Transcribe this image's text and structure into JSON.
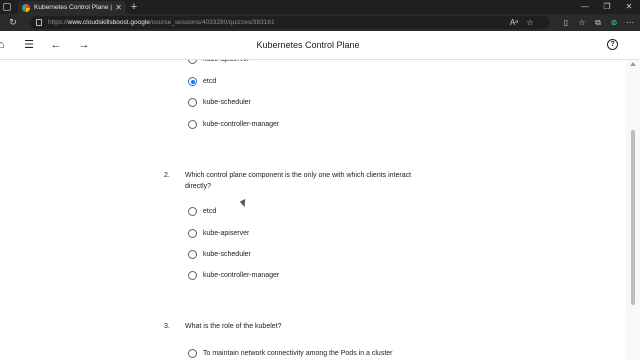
{
  "browser": {
    "tab_title": "Kubernetes Control Plane | Goo",
    "tab_close": "✕",
    "new_tab": "+",
    "url_prefix": "https://",
    "url_host": "www.cloudskillsboost.google",
    "url_path": "/course_sessions/4033280/quizzes/383161",
    "window_controls": [
      "—",
      "❐",
      "✕"
    ]
  },
  "header": {
    "title": "Kubernetes Control Plane",
    "help": "?"
  },
  "question1": {
    "partial_option": "kube-apiserver",
    "options": [
      {
        "label": "etcd",
        "checked": true
      },
      {
        "label": "kube-scheduler",
        "checked": false
      },
      {
        "label": "kube-controller-manager",
        "checked": false
      }
    ]
  },
  "question2": {
    "number": "2.",
    "text": "Which control plane component is the only one with which clients interact directly?",
    "options": [
      {
        "label": "etcd"
      },
      {
        "label": "kube-apiserver"
      },
      {
        "label": "kube-scheduler"
      },
      {
        "label": "kube-controller-manager"
      }
    ]
  },
  "question3": {
    "number": "3.",
    "text": "What is the role of the kubelet?",
    "options": [
      {
        "label": "To maintain network connectivity among the Pods in a cluster"
      }
    ]
  },
  "colors": {
    "accent": "#1a73e8",
    "text": "#202124",
    "chrome_dark": "#1f1f1f"
  }
}
